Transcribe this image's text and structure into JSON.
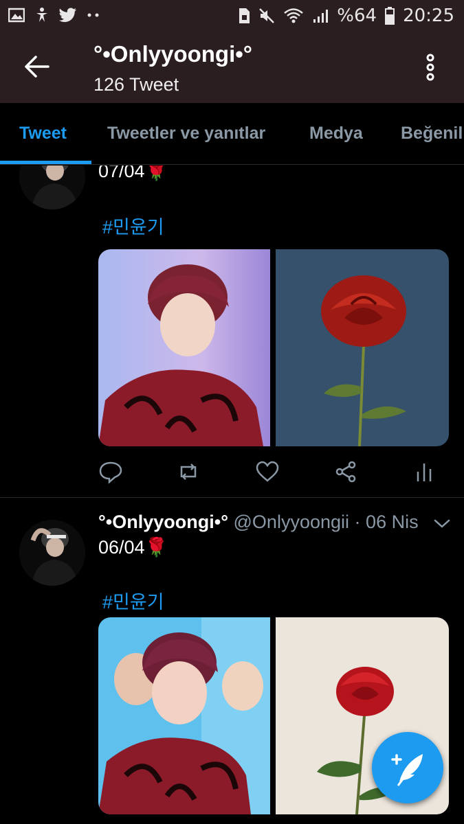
{
  "status_bar": {
    "battery": "%64",
    "time": "20:25",
    "left_icons": [
      "image-icon",
      "accessibility-icon",
      "twitter-icon",
      "more-dots-icon"
    ],
    "right_icons": [
      "sim-icon",
      "mute-icon",
      "wifi-icon",
      "signal-icon",
      "battery-icon"
    ]
  },
  "header": {
    "title": "°•Onlyyoongi•°",
    "subtitle": "126 Tweet"
  },
  "tabs": [
    {
      "label": "Tweet",
      "active": true
    },
    {
      "label": "Tweetler ve yanıtlar",
      "active": false
    },
    {
      "label": "Medya",
      "active": false
    },
    {
      "label": "Beğenil",
      "active": false
    }
  ],
  "tweets": [
    {
      "text": "07/04🌹",
      "hashtag": "#민윤기",
      "media": [
        "photo-person-pink-background",
        "photo-red-rose-blue-background"
      ]
    },
    {
      "name": "°•Onlyyoongi•°",
      "handle": "@Onlyyoongii",
      "separator": "·",
      "date": "06 Nis",
      "text": "06/04🌹",
      "hashtag": "#민윤기",
      "media": [
        "photo-person-laughing-blue-background",
        "photo-red-rose-white-background"
      ]
    }
  ],
  "colors": {
    "accent": "#1d9bf0",
    "header_bg": "#2a1e21",
    "muted": "#8b98a5",
    "background": "#000000"
  }
}
